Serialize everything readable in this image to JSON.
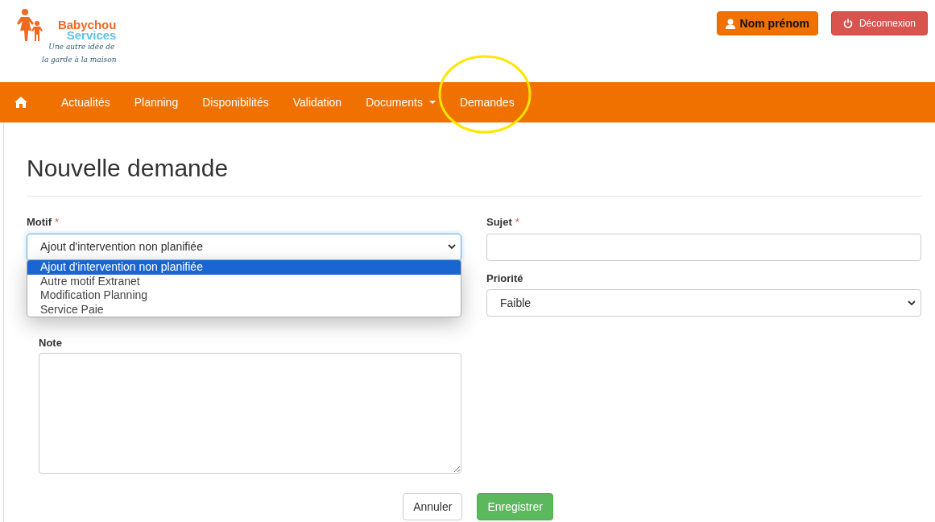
{
  "logo": {
    "brand_line1": "Babychou",
    "brand_line2": "Services",
    "tagline_line1": "Une autre idée de",
    "tagline_line2": "la garde à la maison"
  },
  "header_buttons": [
    {
      "kind": "user",
      "label": "Nom prénom"
    },
    {
      "kind": "logout",
      "label": "Déconnexion"
    }
  ],
  "nav": {
    "items": [
      {
        "kind": "home"
      },
      {
        "kind": "link",
        "label": "Actualités",
        "highlighted": false
      },
      {
        "kind": "link",
        "label": "Planning",
        "highlighted": false
      },
      {
        "kind": "link",
        "label": "Disponibilités",
        "highlighted": false
      },
      {
        "kind": "link",
        "label": "Validation",
        "highlighted": false
      },
      {
        "kind": "dropdown",
        "label": "Documents",
        "highlighted": false
      },
      {
        "kind": "link",
        "label": "Demandes",
        "highlighted": true
      }
    ]
  },
  "page_title": "Nouvelle demande",
  "form": {
    "motif": {
      "label": "Motif",
      "required": "*",
      "value": "Ajout d'intervention non planifiée",
      "expanded": true,
      "options": [
        {
          "label": "Ajout d'intervention non planifiée",
          "selected": true
        },
        {
          "label": "Autre motif Extranet",
          "selected": false
        },
        {
          "label": "Modification Planning",
          "selected": false
        },
        {
          "label": "Service Paie",
          "selected": false
        }
      ]
    },
    "sujet": {
      "label": "Sujet",
      "required": "*"
    },
    "priorite": {
      "label": "Priorité",
      "value": "Faible"
    },
    "note": {
      "label": "Note"
    }
  },
  "buttons": [
    {
      "kind": "cancel",
      "label": "Annuler"
    },
    {
      "kind": "save",
      "label": "Enregistrer"
    }
  ]
}
